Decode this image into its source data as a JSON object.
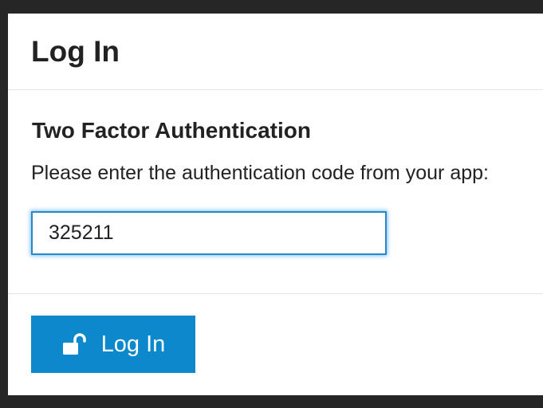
{
  "modal": {
    "title": "Log In",
    "heading": "Two Factor Authentication",
    "instructions": "Please enter the authentication code from your app:",
    "code_input": {
      "value": "325211",
      "placeholder": ""
    },
    "login_button": {
      "label": "Log In",
      "icon": "unlock-icon"
    }
  },
  "colors": {
    "accent": "#0b89cc",
    "focus_border": "#2a88c8",
    "backdrop": "#262626",
    "text": "#222222"
  }
}
